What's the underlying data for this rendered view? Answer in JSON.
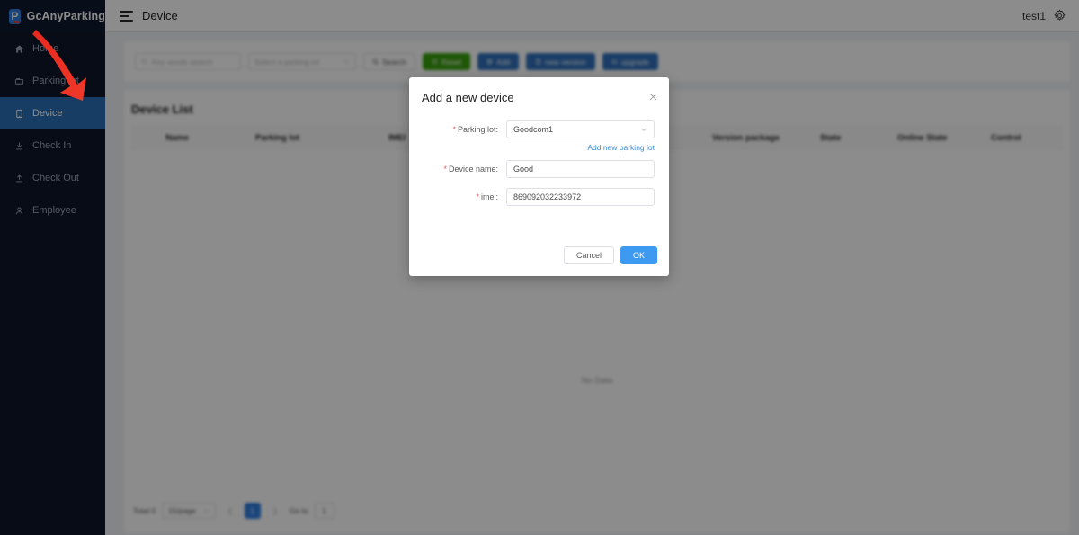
{
  "brand": {
    "name": "GcAnyParking",
    "logo_letter": "P"
  },
  "topbar": {
    "title": "Device",
    "menu_icon": "hamburger-icon",
    "user": "test1",
    "settings_icon": "gear-icon"
  },
  "sidebar": {
    "items": [
      {
        "label": "Home",
        "icon": "home-icon",
        "active": false
      },
      {
        "label": "Parking lot",
        "icon": "parking-icon",
        "active": false
      },
      {
        "label": "Device",
        "icon": "device-icon",
        "active": true
      },
      {
        "label": "Check In",
        "icon": "check-in-icon",
        "active": false
      },
      {
        "label": "Check Out",
        "icon": "check-out-icon",
        "active": false
      },
      {
        "label": "Employee",
        "icon": "employee-icon",
        "active": false
      }
    ]
  },
  "filter": {
    "keyword_placeholder": "Key words search",
    "parking_lot_placeholder": "Select a parking lot",
    "buttons": [
      {
        "label": "Search",
        "style": "default",
        "icon": "search-icon"
      },
      {
        "label": "Reset",
        "style": "green",
        "icon": "reset-icon"
      },
      {
        "label": "Add",
        "style": "blue",
        "icon": "plus-icon"
      },
      {
        "label": "new version",
        "style": "blue",
        "icon": "file-icon"
      },
      {
        "label": "upgrade",
        "style": "blue",
        "icon": "cloud-icon"
      }
    ]
  },
  "table": {
    "title": "Device List",
    "columns": [
      "Name",
      "Parking lot",
      "IMEI",
      "Version package",
      "State",
      "Online State",
      "Control"
    ],
    "rows": [],
    "empty_text": "No Data"
  },
  "pagination": {
    "total_label": "Total 0",
    "page_size": "15/page",
    "prev_icon": "chevron-left-icon",
    "next_icon": "chevron-right-icon",
    "current_page": "1",
    "goto_label": "Go to",
    "goto_value": "1"
  },
  "modal": {
    "title": "Add a new device",
    "close_icon": "close-icon",
    "fields": [
      {
        "label": "Parking lot",
        "required": true,
        "value": "Goodcom1",
        "type": "select"
      },
      {
        "label": "Device name",
        "required": true,
        "value": "Good",
        "type": "text"
      },
      {
        "label": "imei",
        "required": true,
        "value": "869092032233972",
        "type": "text"
      }
    ],
    "helper_link": "Add new parking lot",
    "cancel_label": "Cancel",
    "ok_label": "OK"
  },
  "annotation": {
    "arrow_color": "#e8281e"
  },
  "colors": {
    "sidebar_bg": "#0f1729",
    "sidebar_active": "#2a6fb8",
    "accent_blue": "#2f7fe0",
    "green": "#389e0d",
    "primary_blue": "#3d9af0",
    "link_blue": "#3d8bd6"
  }
}
